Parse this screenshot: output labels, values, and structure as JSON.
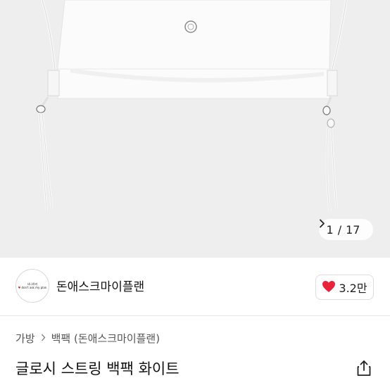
{
  "gallery": {
    "current": "1",
    "divider": "/",
    "total": "17",
    "next_icon": "chevron-right-icon"
  },
  "seller": {
    "avatar_text_line1": "사나하라",
    "avatar_text_line2": "don't ask my plan",
    "name": "돈애스크마이플랜",
    "like_count": "3.2만",
    "like_color": "#e8243a"
  },
  "breadcrumb": {
    "level1": "가방",
    "level2": "백팩 (돈애스크마이플랜)"
  },
  "product": {
    "title": "글로시 스트링 백팩 화이트",
    "share_icon": "share-icon"
  }
}
